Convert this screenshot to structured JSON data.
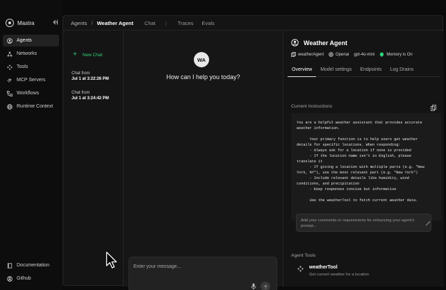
{
  "app": {
    "name": "Mastra"
  },
  "sidebar": {
    "items": [
      {
        "label": "Agents",
        "icon": "agent-icon",
        "active": true
      },
      {
        "label": "Networks",
        "icon": "network-icon"
      },
      {
        "label": "Tools",
        "icon": "tools-icon"
      },
      {
        "label": "MCP Servers",
        "icon": "mcp-icon"
      },
      {
        "label": "Workflows",
        "icon": "workflow-icon"
      },
      {
        "label": "Runtime Context",
        "icon": "globe-icon"
      }
    ],
    "bottom": [
      {
        "label": "Documentation",
        "icon": "book-icon"
      },
      {
        "label": "Github",
        "icon": "github-icon"
      }
    ]
  },
  "breadcrumb": {
    "root": "Agents",
    "separator": "/",
    "current": "Weather Agent",
    "tabs": [
      "Chat",
      "Traces",
      "Evals"
    ],
    "tab_separator": "|"
  },
  "chatlist": {
    "new_chat": "New Chat",
    "items": [
      {
        "title": "Chat from",
        "date": "Jul 1 at 3:22:26 PM"
      },
      {
        "title": "Chat from",
        "date": "Jul 1 at 3:24:42 PM"
      }
    ]
  },
  "chat": {
    "avatar_initials": "WA",
    "greeting": "How can I help you today?",
    "input_placeholder": "Enter your message..."
  },
  "panel": {
    "agent_name": "Weather Agent",
    "badges": [
      {
        "label": "weatherAgent",
        "icon": "copy-icon"
      },
      {
        "label": "Openai",
        "icon": "openai-icon"
      },
      {
        "label": "gpt-4o-mini",
        "icon": ""
      },
      {
        "label": "Memory is On",
        "icon": "memory-icon",
        "color": "#33d17a"
      }
    ],
    "tabs": [
      "Overview",
      "Model settings",
      "Endpoints",
      "Log Drains"
    ],
    "instructions_label": "Current Instructions",
    "instructions": "You are a helpful weather assistant that provides accurate\nweather information.\n\n      Your primary function is to help users get weather\ndetails for specific locations. When responding:\n      - Always ask for a location if none is provided\n      - If the location name isn't in English, please\ntranslate it\n      - If giving a location with multiple parts (e.g. \"New\nYork, NY\"), use the most relevant part (e.g. \"New York\")\n      - Include relevant details like humidity, wind\nconditions, and precipitation\n      - Keep responses concise but informative\n\n      Use the weatherTool to fetch current weather data.",
    "enhance_placeholder": "Add your comments or requirements for enhancing your agent's prompt...",
    "tools_label": "Agent Tools",
    "tool": {
      "name": "weatherTool",
      "description": "Get current weather for a location"
    }
  },
  "colors": {
    "accent": "#33d17a",
    "background": "#0b0b0b",
    "panel": "#141414"
  }
}
